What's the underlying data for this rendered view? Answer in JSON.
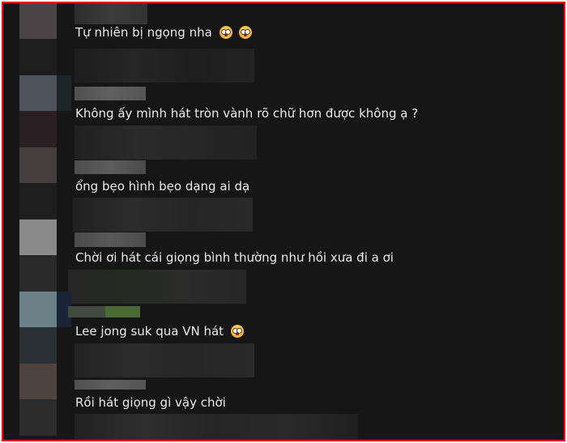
{
  "comments": [
    {
      "text": "Tự nhiên bị ngọng nha",
      "emojis": [
        "flushed-face-icon",
        "flushed-face-icon"
      ]
    },
    {
      "text": "Không ấy mình hát tròn vành rõ chữ hơn được không ạ ?",
      "emojis": []
    },
    {
      "text": "ổng bẹo hình bẹo dạng ai dạ",
      "emojis": []
    },
    {
      "text": "Chời ơi hát cái giọng bình thường như hồi xưa đi a ơi",
      "emojis": []
    },
    {
      "text": "Lee jong suk qua VN hát",
      "emojis": [
        "flushed-face-icon"
      ]
    },
    {
      "text": "Rồi hát giọng gì vậy chời",
      "emojis": []
    }
  ],
  "colors": {
    "frame_border": "#e8141b",
    "background": "#161616",
    "comment_text": "#ebebeb"
  }
}
